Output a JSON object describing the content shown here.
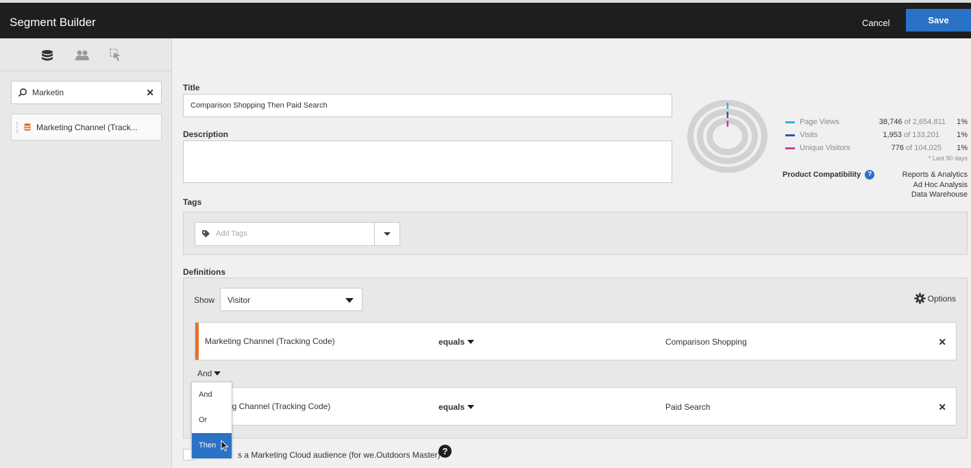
{
  "header": {
    "title": "Segment Builder",
    "cancel_label": "Cancel",
    "save_label": "Save"
  },
  "left_panel": {
    "tabs": [
      {
        "icon": "dimensions-icon"
      },
      {
        "icon": "segments-icon"
      },
      {
        "icon": "cursor-select-icon"
      }
    ],
    "search": {
      "value": "Marketin"
    },
    "results": [
      {
        "label": "Marketing Channel (Track..."
      }
    ]
  },
  "form": {
    "title_label": "Title",
    "title_value": "Comparison Shopping Then Paid Search",
    "description_label": "Description",
    "description_value": "",
    "tags_label": "Tags",
    "tags_placeholder": "Add Tags",
    "definitions_label": "Definitions"
  },
  "definitions": {
    "show_label": "Show",
    "show_value": "Visitor",
    "options_label": "Options",
    "rules": [
      {
        "dimension": "Marketing Channel (Tracking Code)",
        "operator": "equals",
        "value": "Comparison Shopping"
      },
      {
        "dimension": "ng Channel (Tracking Code)",
        "operator": "equals",
        "value": "Paid Search"
      }
    ],
    "conjunction": "And",
    "menu": [
      "And",
      "Or",
      "Then"
    ],
    "menu_selected": "Then"
  },
  "audience": {
    "label": "s a Marketing Cloud audience (for we.Outdoors Master)"
  },
  "stats": {
    "metrics": [
      {
        "name": "Page Views",
        "value": "38,746",
        "of": "of 2,654,811",
        "pct": "1%",
        "color": "#2fb3d8"
      },
      {
        "name": "Visits",
        "value": "1,953",
        "of": "of 133,201",
        "pct": "1%",
        "color": "#3c4ea8"
      },
      {
        "name": "Unique Visitors",
        "value": "776",
        "of": "of 104,025",
        "pct": "1%",
        "color": "#c83c9a"
      }
    ],
    "note": "* Last 90 days",
    "compat_label": "Product Compatibility",
    "compat_list": [
      "Reports & Analytics",
      "Ad Hoc Analysis",
      "Data Warehouse"
    ]
  }
}
